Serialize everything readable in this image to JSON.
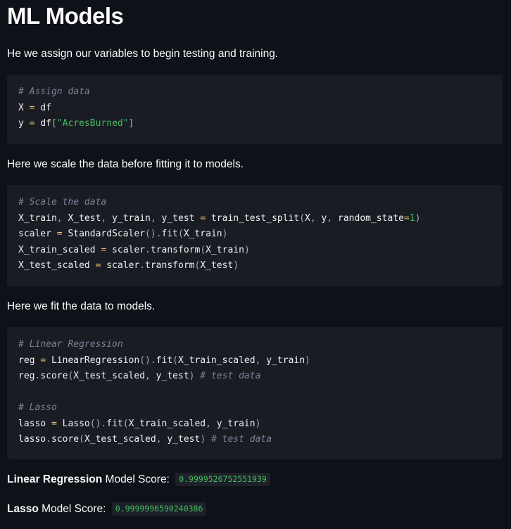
{
  "title": "ML Models",
  "paragraphs": [
    "He we assign our variables to begin testing and training.",
    "Here we scale the data before fitting it to models.",
    "Here we fit the data to models."
  ],
  "code_blocks": [
    {
      "lines": [
        [
          {
            "t": "# Assign data",
            "c": "cm"
          }
        ],
        [
          {
            "t": "X ",
            "c": ""
          },
          {
            "t": "=",
            "c": "op"
          },
          {
            "t": " df",
            "c": ""
          }
        ],
        [
          {
            "t": "y ",
            "c": ""
          },
          {
            "t": "=",
            "c": "op"
          },
          {
            "t": " df",
            "c": ""
          },
          {
            "t": "[",
            "c": "pn"
          },
          {
            "t": "\"AcresBurned\"",
            "c": "st"
          },
          {
            "t": "]",
            "c": "pn"
          }
        ]
      ]
    },
    {
      "lines": [
        [
          {
            "t": "# Scale the data",
            "c": "cm"
          }
        ],
        [
          {
            "t": "X_train",
            "c": ""
          },
          {
            "t": ",",
            "c": "pn"
          },
          {
            "t": " X_test",
            "c": ""
          },
          {
            "t": ",",
            "c": "pn"
          },
          {
            "t": " y_train",
            "c": ""
          },
          {
            "t": ",",
            "c": "pn"
          },
          {
            "t": " y_test ",
            "c": ""
          },
          {
            "t": "=",
            "c": "op"
          },
          {
            "t": " train_test_split",
            "c": ""
          },
          {
            "t": "(",
            "c": "pn"
          },
          {
            "t": "X",
            "c": ""
          },
          {
            "t": ",",
            "c": "pn"
          },
          {
            "t": " y",
            "c": ""
          },
          {
            "t": ",",
            "c": "pn"
          },
          {
            "t": " random_state",
            "c": ""
          },
          {
            "t": "=",
            "c": "op"
          },
          {
            "t": "1",
            "c": "nm"
          },
          {
            "t": ")",
            "c": "pn"
          }
        ],
        [
          {
            "t": "scaler ",
            "c": ""
          },
          {
            "t": "=",
            "c": "op"
          },
          {
            "t": " StandardScaler",
            "c": ""
          },
          {
            "t": "().",
            "c": "pn"
          },
          {
            "t": "fit",
            "c": ""
          },
          {
            "t": "(",
            "c": "pn"
          },
          {
            "t": "X_train",
            "c": ""
          },
          {
            "t": ")",
            "c": "pn"
          }
        ],
        [
          {
            "t": "X_train_scaled ",
            "c": ""
          },
          {
            "t": "=",
            "c": "op"
          },
          {
            "t": " scaler",
            "c": ""
          },
          {
            "t": ".",
            "c": "pn"
          },
          {
            "t": "transform",
            "c": ""
          },
          {
            "t": "(",
            "c": "pn"
          },
          {
            "t": "X_train",
            "c": ""
          },
          {
            "t": ")",
            "c": "pn"
          }
        ],
        [
          {
            "t": "X_test_scaled ",
            "c": ""
          },
          {
            "t": "=",
            "c": "op"
          },
          {
            "t": " scaler",
            "c": ""
          },
          {
            "t": ".",
            "c": "pn"
          },
          {
            "t": "transform",
            "c": ""
          },
          {
            "t": "(",
            "c": "pn"
          },
          {
            "t": "X_test",
            "c": ""
          },
          {
            "t": ")",
            "c": "pn"
          }
        ]
      ]
    },
    {
      "lines": [
        [
          {
            "t": "# Linear Regression",
            "c": "cm"
          }
        ],
        [
          {
            "t": "reg ",
            "c": ""
          },
          {
            "t": "=",
            "c": "op"
          },
          {
            "t": " LinearRegression",
            "c": ""
          },
          {
            "t": "().",
            "c": "pn"
          },
          {
            "t": "fit",
            "c": ""
          },
          {
            "t": "(",
            "c": "pn"
          },
          {
            "t": "X_train_scaled",
            "c": ""
          },
          {
            "t": ",",
            "c": "pn"
          },
          {
            "t": " y_train",
            "c": ""
          },
          {
            "t": ")",
            "c": "pn"
          }
        ],
        [
          {
            "t": "reg",
            "c": ""
          },
          {
            "t": ".",
            "c": "pn"
          },
          {
            "t": "score",
            "c": ""
          },
          {
            "t": "(",
            "c": "pn"
          },
          {
            "t": "X_test_scaled",
            "c": ""
          },
          {
            "t": ",",
            "c": "pn"
          },
          {
            "t": " y_test",
            "c": ""
          },
          {
            "t": ")",
            "c": "pn"
          },
          {
            "t": " # test data",
            "c": "cm"
          }
        ],
        [],
        [
          {
            "t": "# Lasso",
            "c": "cm"
          }
        ],
        [
          {
            "t": "lasso ",
            "c": ""
          },
          {
            "t": "=",
            "c": "op"
          },
          {
            "t": " Lasso",
            "c": ""
          },
          {
            "t": "().",
            "c": "pn"
          },
          {
            "t": "fit",
            "c": ""
          },
          {
            "t": "(",
            "c": "pn"
          },
          {
            "t": "X_train_scaled",
            "c": ""
          },
          {
            "t": ",",
            "c": "pn"
          },
          {
            "t": " y_train",
            "c": ""
          },
          {
            "t": ")",
            "c": "pn"
          }
        ],
        [
          {
            "t": "lasso",
            "c": ""
          },
          {
            "t": ".",
            "c": "pn"
          },
          {
            "t": "score",
            "c": ""
          },
          {
            "t": "(",
            "c": "pn"
          },
          {
            "t": "X_test_scaled",
            "c": ""
          },
          {
            "t": ",",
            "c": "pn"
          },
          {
            "t": " y_test",
            "c": ""
          },
          {
            "t": ")",
            "c": "pn"
          },
          {
            "t": " # test data",
            "c": "cm"
          }
        ]
      ]
    }
  ],
  "scores": {
    "linear": {
      "bold": "Linear Regression",
      "rest": " Model Score:",
      "value": "0.9999526752551939"
    },
    "lasso": {
      "bold": "Lasso",
      "rest": " Model Score:",
      "value": "0.9999996590240386"
    }
  }
}
